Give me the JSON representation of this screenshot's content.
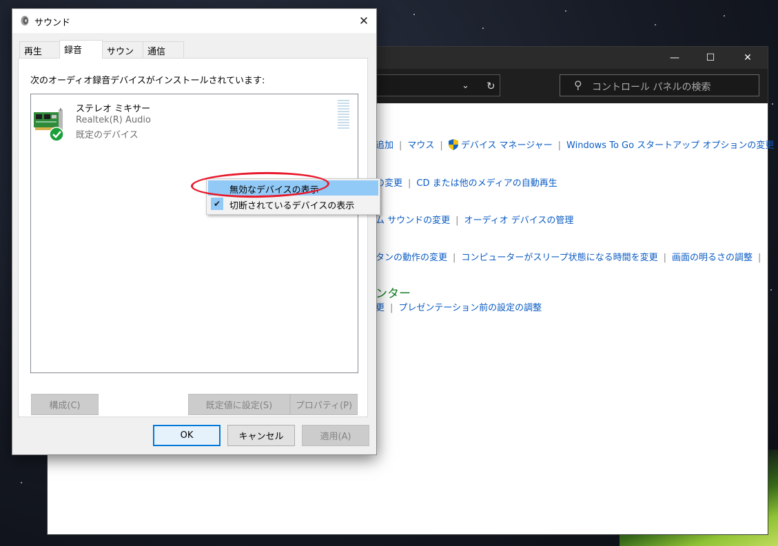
{
  "sound_dialog": {
    "title": "サウンド",
    "close_label": "✕",
    "tabs": [
      {
        "label": "再生",
        "active": false
      },
      {
        "label": "録音",
        "active": true
      },
      {
        "label": "サウンド",
        "active": false
      },
      {
        "label": "通信",
        "active": false
      }
    ],
    "panel_caption": "次のオーディオ録音デバイスがインストールされています:",
    "devices": [
      {
        "name": "ステレオ ミキサー",
        "driver": "Realtek(R) Audio",
        "status": "既定のデバイス",
        "icon": "sound-card-icon",
        "status_icon": "checkmark-icon"
      }
    ],
    "buttons": {
      "configure": "構成(C)",
      "set_default": "既定値に設定(S)",
      "properties": "プロパティ(P)",
      "ok": "OK",
      "cancel": "キャンセル",
      "apply": "適用(A)"
    },
    "context_menu": [
      {
        "label": "無効なデバイスの表示",
        "checked": false,
        "hovered": true
      },
      {
        "label": "切断されているデバイスの表示",
        "checked": true,
        "hovered": false
      }
    ]
  },
  "control_panel": {
    "search_placeholder": "コントロール パネルの検索",
    "lines": {
      "devices": [
        "追加",
        "マウス",
        "デバイス マネージャー",
        "Windows To Go スタートアップ オプションの変更"
      ],
      "autoplay": [
        "の変更",
        "CD または他のメディアの自動再生"
      ],
      "sound": [
        "ム サウンドの変更",
        "オーディオ デバイスの管理"
      ],
      "power": [
        "タンの動作の変更",
        "コンピューターがスリープ状態になる時間を変更",
        "画面の明るさの調整"
      ],
      "mobility_heading": "ンター",
      "mobility": [
        "更",
        "プレゼンテーション前の設定の調整"
      ]
    }
  },
  "colors": {
    "link": "#0a5bc4",
    "heading": "#117a1f",
    "menu_hover": "#91c9f7",
    "highlight": "#e8192c",
    "default_button_border": "#0078d7"
  }
}
